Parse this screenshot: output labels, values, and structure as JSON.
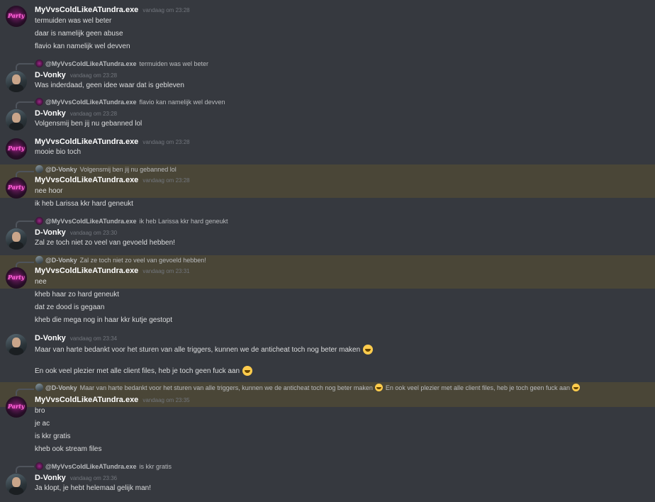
{
  "users": {
    "myvvs": "MyVvsColdLikeATundra.exe",
    "dvonky": "D-Vonky"
  },
  "colors": {
    "background": "#36393f",
    "highlight": "#4a4637",
    "username": "#ffffff",
    "timestamp": "#72767d",
    "text": "#dcddde"
  },
  "messages": [
    {
      "author": "MyVvsColdLikeATundra.exe",
      "time": "vandaag om 23:28",
      "lines": [
        "termuiden was wel beter",
        "daar is namelijk geen abuse",
        "flavio kan namelijk wel devven"
      ]
    },
    {
      "reply_name": "@MyVvsColdLikeATundra.exe",
      "reply_text": "termuiden was wel beter",
      "author": "D-Vonky",
      "time": "vandaag om 23:28",
      "lines": [
        "Was inderdaad, geen idee waar dat is gebleven"
      ]
    },
    {
      "reply_name": "@MyVvsColdLikeATundra.exe",
      "reply_text": "flavio kan namelijk wel devven",
      "author": "D-Vonky",
      "time": "vandaag om 23:28",
      "lines": [
        "Volgensmij ben jij nu gebanned lol"
      ]
    },
    {
      "author": "MyVvsColdLikeATundra.exe",
      "time": "vandaag om 23:28",
      "lines": [
        "mooie bio toch"
      ]
    },
    {
      "reply_name": "@D-Vonky",
      "reply_text": "Volgensmij ben jij nu gebanned lol",
      "author": "MyVvsColdLikeATundra.exe",
      "time": "vandaag om 23:28",
      "lines": [
        "nee hoor",
        "ik heb Larissa kkr hard geneukt"
      ]
    },
    {
      "reply_name": "@MyVvsColdLikeATundra.exe",
      "reply_text": "ik heb Larissa kkr hard geneukt",
      "author": "D-Vonky",
      "time": "vandaag om 23:30",
      "lines": [
        "Zal ze toch niet zo veel van gevoeld hebben!"
      ]
    },
    {
      "reply_name": "@D-Vonky",
      "reply_text": "Zal ze toch niet zo veel van gevoeld hebben!",
      "author": "MyVvsColdLikeATundra.exe",
      "time": "vandaag om 23:31",
      "lines": [
        "nee",
        "kheb haar zo hard geneukt",
        "dat ze dood is gegaan",
        "kheb die mega nog in haar kkr kutje gestopt"
      ]
    },
    {
      "author": "D-Vonky",
      "time": "vandaag om 23:34",
      "lines": [
        "Maar van harte bedankt voor het sturen van alle triggers, kunnen we de anticheat toch nog beter maken",
        "En ook veel plezier met alle client files, heb je toch geen fuck aan"
      ],
      "emoji": "grinning-smile-emoji"
    },
    {
      "reply_name": "@D-Vonky",
      "reply_text": "Maar van harte bedankt voor het sturen van alle triggers, kunnen we de anticheat toch nog beter maken",
      "reply_text_2": "En ook veel plezier met alle client files, heb je toch geen fuck aan",
      "author": "MyVvsColdLikeATundra.exe",
      "time": "vandaag om 23:35",
      "lines": [
        "bro",
        "je ac",
        "is kkr gratis",
        "kheb ook stream files"
      ]
    },
    {
      "reply_name": "@MyVvsColdLikeATundra.exe",
      "reply_text": "is kkr gratis",
      "author": "D-Vonky",
      "time": "vandaag om 23:36",
      "lines": [
        "Ja klopt, je hebt helemaal gelijk man!"
      ]
    }
  ]
}
